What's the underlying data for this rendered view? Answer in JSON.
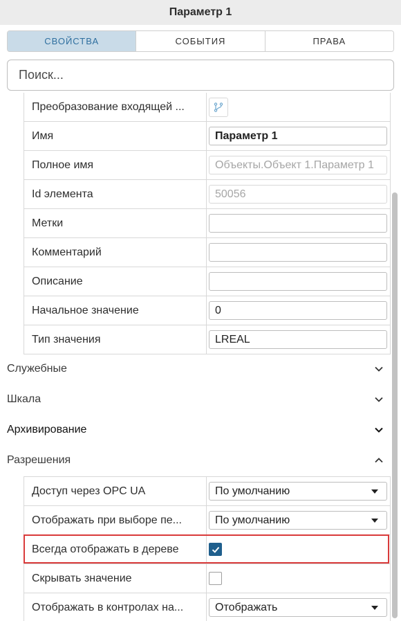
{
  "window": {
    "title": "Параметр 1"
  },
  "tabs": [
    {
      "label": "СВОЙСТВА",
      "active": true
    },
    {
      "label": "СОБЫТИЯ",
      "active": false
    },
    {
      "label": "ПРАВА",
      "active": false
    }
  ],
  "search": {
    "placeholder": "Поиск..."
  },
  "properties": {
    "transform": {
      "label": "Преобразование входящей ..."
    },
    "name": {
      "label": "Имя",
      "value": "Параметр 1"
    },
    "full_name": {
      "label": "Полное имя",
      "value": "Объекты.Объект 1.Параметр 1"
    },
    "element_id": {
      "label": "Id элемента",
      "value": "50056"
    },
    "tags": {
      "label": "Метки",
      "value": ""
    },
    "comment": {
      "label": "Комментарий",
      "value": ""
    },
    "description": {
      "label": "Описание",
      "value": ""
    },
    "initial_value": {
      "label": "Начальное значение",
      "value": "0"
    },
    "value_type": {
      "label": "Тип значения",
      "value": "LREAL"
    }
  },
  "sections": {
    "service": {
      "label": "Служебные",
      "expanded": false
    },
    "scale": {
      "label": "Шкала",
      "expanded": false
    },
    "archiving": {
      "label": "Архивирование",
      "expanded": false
    },
    "permissions": {
      "label": "Разрешения",
      "expanded": true
    }
  },
  "permissions": {
    "opc_access": {
      "label": "Доступ через OPC UA",
      "value": "По умолчанию"
    },
    "show_on_select": {
      "label": "Отображать при выборе пе...",
      "value": "По умолчанию"
    },
    "always_show_tree": {
      "label": "Всегда отображать в дереве",
      "checked": true
    },
    "hide_value": {
      "label": "Скрывать значение",
      "checked": false
    },
    "show_in_controls": {
      "label": "Отображать в контролах на...",
      "value": "Отображать"
    }
  },
  "colors": {
    "accent": "#1f5f8d",
    "tab_active_bg": "#c9dbe8",
    "highlight": "#d93a3a"
  }
}
